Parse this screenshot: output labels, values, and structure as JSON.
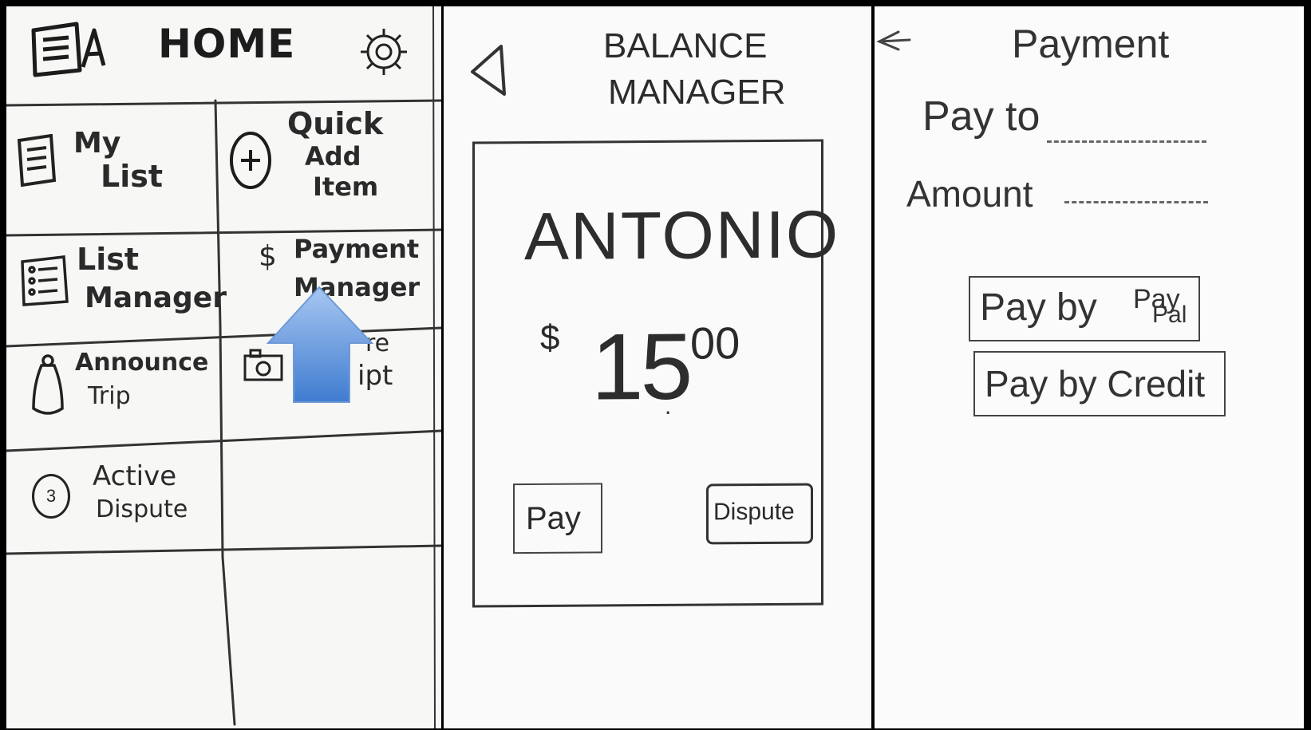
{
  "home": {
    "title": "HOME",
    "tiles": {
      "my_list": [
        "My",
        "List"
      ],
      "quick_add": [
        "Quick",
        "Add",
        "Item"
      ],
      "list_manager": [
        "List",
        "Manager"
      ],
      "payment_manager": [
        "Payment",
        "Manager"
      ],
      "announce_trip": [
        "Announce",
        "Trip"
      ],
      "receipt_partial": [
        "re",
        "ipt"
      ],
      "active_dispute": [
        "Active",
        "Dispute"
      ],
      "dispute_badge": "3"
    },
    "accent_color": "#5f95d9"
  },
  "balance": {
    "title": [
      "BALANCE",
      "MANAGER"
    ],
    "name": "ANTONIO",
    "currency": "$",
    "amount_whole": "15",
    "amount_cents": "00",
    "pay_label": "Pay",
    "dispute_label": "Dispute"
  },
  "payment": {
    "title": "Payment",
    "pay_to_label": "Pay to",
    "amount_label": "Amount",
    "paypal_label": "Pay by",
    "paypal_logo": [
      "Pay",
      "Pal"
    ],
    "credit_label": "Pay by Credit"
  }
}
